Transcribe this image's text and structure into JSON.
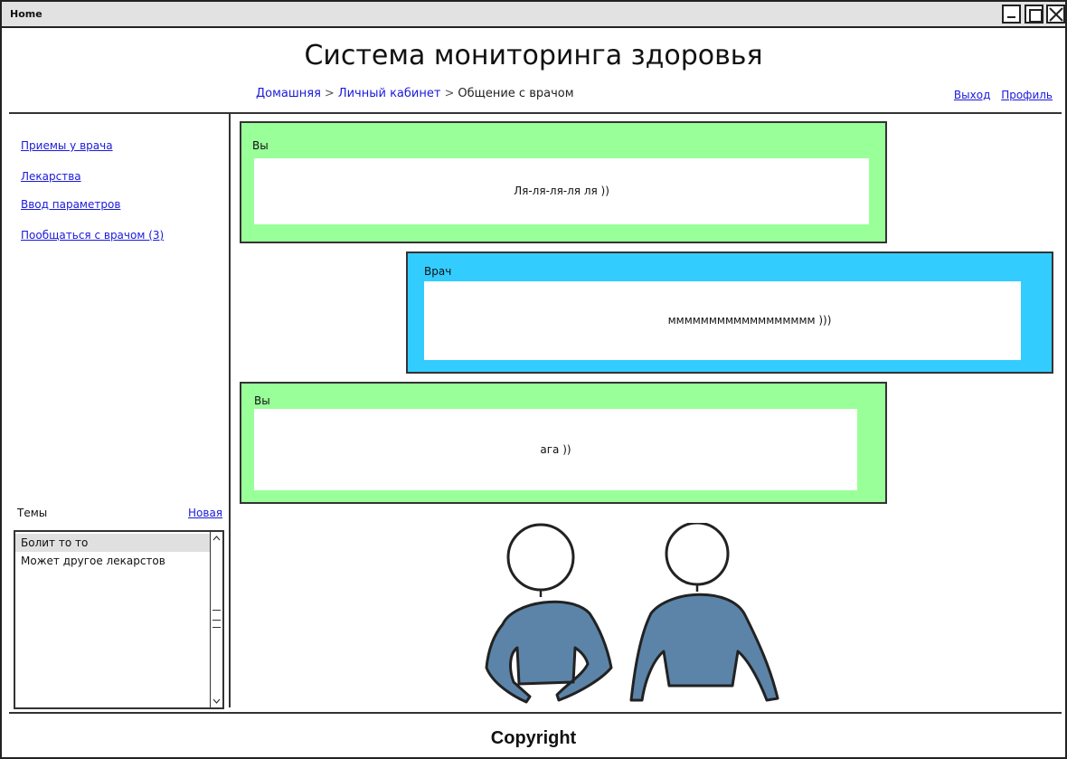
{
  "window": {
    "title": "Home"
  },
  "header": {
    "title": "Система мониторинга здоровья"
  },
  "breadcrumb": {
    "items": [
      "Домашняя",
      "Личный кабинет"
    ],
    "separator": ">",
    "current": "Общение с врачом"
  },
  "toplinks": {
    "logout": "Выход",
    "profile": "Профиль"
  },
  "nav": {
    "items": [
      {
        "label": "Приемы у врача"
      },
      {
        "label": "Лекарства"
      },
      {
        "label": "Ввод параметров"
      },
      {
        "label": "Пообщаться с врачом (3)"
      }
    ]
  },
  "topics": {
    "label": "Темы",
    "new_link": "Новая",
    "items": [
      {
        "label": "Болит то то",
        "selected": true
      },
      {
        "label": "Может другое лекарстов",
        "selected": false
      }
    ]
  },
  "messages": [
    {
      "author": "Вы",
      "text": "Ля-ля-ля-ля ля ))",
      "color": "#99ff99"
    },
    {
      "author": "Врач",
      "text": "мммммммммммммммммм )))",
      "color": "#33ccff"
    },
    {
      "author": "Вы",
      "text": "ага ))",
      "color": "#99ff99"
    }
  ],
  "illustration": {
    "icon": "two-people-icon",
    "shirt_color": "#5b84a8"
  },
  "footer": {
    "text": "Copyright"
  }
}
